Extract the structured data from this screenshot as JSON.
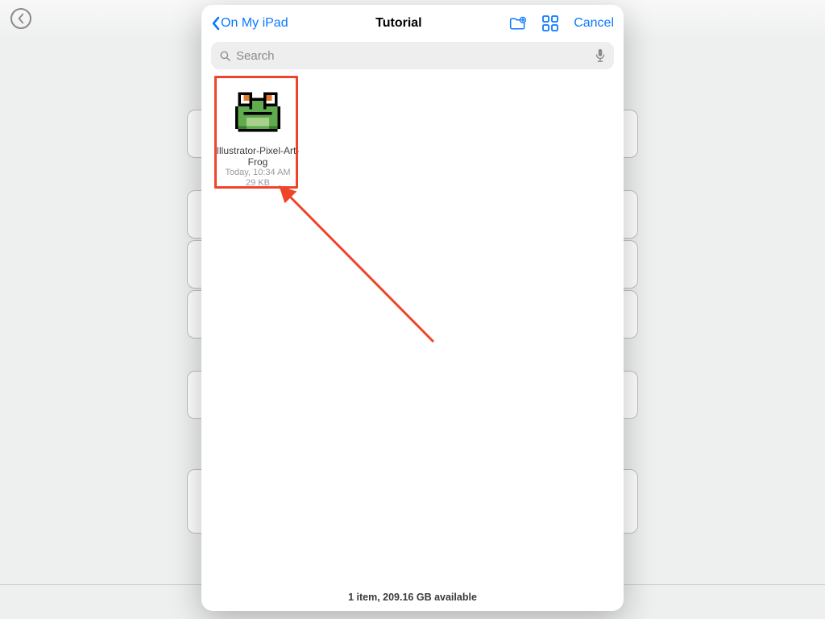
{
  "header": {
    "back_label": "On My iPad",
    "title": "Tutorial",
    "cancel_label": "Cancel"
  },
  "search": {
    "placeholder": "Search"
  },
  "files": [
    {
      "name": "Illustrator-Pixel-Art-Frog",
      "date": "Today, 10:34 AM",
      "size": "29 KB"
    }
  ],
  "footer": {
    "status": "1 item, 209.16 GB available"
  }
}
